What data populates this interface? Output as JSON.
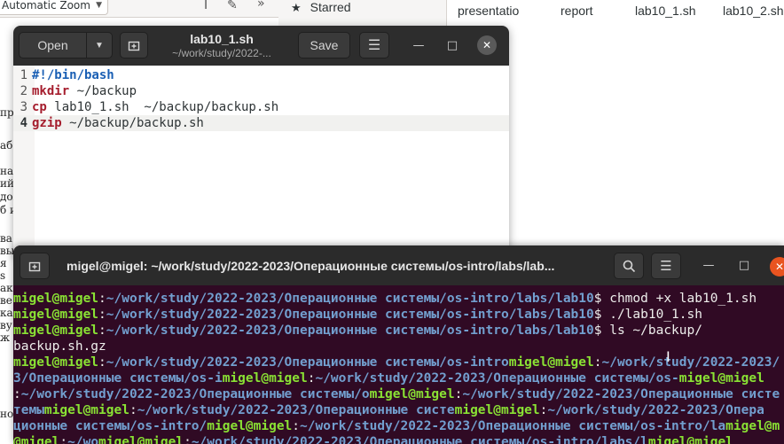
{
  "pdf_viewer": {
    "zoom_value": "Automatic Zoom",
    "side_text": [
      "пр",
      "або",
      "нат",
      "ий",
      "дол",
      "б и",
      "ва",
      "вы",
      "я",
      "s",
      "ак",
      "ве",
      "кач",
      "ву",
      "ж",
      "но"
    ]
  },
  "file_manager": {
    "sidebar_starred": "Starred",
    "files": [
      "presentatio",
      "report",
      "lab10_1.sh",
      "lab10_2.sh"
    ]
  },
  "gedit": {
    "open_label": "Open",
    "save_label": "Save",
    "title": "lab10_1.sh",
    "subtitle": "~/work/study/2022-...",
    "lines": [
      {
        "num": "1",
        "kw": "#!/bin/bash",
        "rest": ""
      },
      {
        "num": "2",
        "kw": "mkdir",
        "rest": " ~/backup"
      },
      {
        "num": "3",
        "kw": "cp",
        "rest": " lab10_1.sh  ~/backup/backup.sh"
      },
      {
        "num": "4",
        "kw": "gzip",
        "rest": " ~/backup/backup.sh"
      }
    ]
  },
  "terminal": {
    "title": "migel@migel: ~/work/study/2022-2023/Операционные системы/os-intro/labs/lab...",
    "lines": [
      [
        {
          "c": "u",
          "t": "migel@migel"
        },
        {
          "c": "plain",
          "t": ":"
        },
        {
          "c": "p",
          "t": "~/work/study/2022-2023/Операционные системы/os-intro/labs/lab10"
        },
        {
          "c": "plain",
          "t": "$ chmod +x lab10_1.sh"
        }
      ],
      [
        {
          "c": "u",
          "t": "migel@migel"
        },
        {
          "c": "plain",
          "t": ":"
        },
        {
          "c": "p",
          "t": "~/work/study/2022-2023/Операционные системы/os-intro/labs/lab10"
        },
        {
          "c": "plain",
          "t": "$ ./lab10_1.sh"
        }
      ],
      [
        {
          "c": "u",
          "t": "migel@migel"
        },
        {
          "c": "plain",
          "t": ":"
        },
        {
          "c": "p",
          "t": "~/work/study/2022-2023/Операционные системы/os-intro/labs/lab10"
        },
        {
          "c": "plain",
          "t": "$ ls ~/backup/"
        }
      ],
      [
        {
          "c": "plain",
          "t": "backup.sh.gz"
        }
      ],
      [
        {
          "c": "u",
          "t": "migel@migel"
        },
        {
          "c": "plain",
          "t": ":"
        },
        {
          "c": "p",
          "t": "~/work/study/2022-2023/Операционные системы/os-intro"
        },
        {
          "c": "u",
          "t": "migel@migel"
        },
        {
          "c": "plain",
          "t": ":"
        },
        {
          "c": "p",
          "t": "~/work/study/2022-2023/"
        }
      ],
      [
        {
          "c": "p",
          "t": "3/Операционные системы/os-i"
        },
        {
          "c": "u",
          "t": "migel@migel"
        },
        {
          "c": "plain",
          "t": ":"
        },
        {
          "c": "p",
          "t": "~/work/study/2022-2023/Операционные системы/os-"
        },
        {
          "c": "u",
          "t": "migel@migel"
        }
      ],
      [
        {
          "c": "plain",
          "t": ":"
        },
        {
          "c": "p",
          "t": "~/work/study/2022-2023/Операционные системы/о"
        },
        {
          "c": "u",
          "t": "migel@migel"
        },
        {
          "c": "plain",
          "t": ":"
        },
        {
          "c": "p",
          "t": "~/work/study/2022-2023/Операционные систе"
        }
      ],
      [
        {
          "c": "p",
          "t": "темы"
        },
        {
          "c": "u",
          "t": "migel@migel"
        },
        {
          "c": "plain",
          "t": ":"
        },
        {
          "c": "p",
          "t": "~/work/study/2022-2023/Операционные систе"
        },
        {
          "c": "u",
          "t": "migel@migel"
        },
        {
          "c": "plain",
          "t": ":"
        },
        {
          "c": "p",
          "t": "~/work/study/2022-2023/Опера"
        }
      ],
      [
        {
          "c": "p",
          "t": "ционные системы/os-intro/"
        },
        {
          "c": "u",
          "t": "migel@migel"
        },
        {
          "c": "plain",
          "t": ":"
        },
        {
          "c": "p",
          "t": "~/work/study/2022-2023/Операционные системы/os-intro/la"
        },
        {
          "c": "u",
          "t": "migel@m"
        }
      ],
      [
        {
          "c": "u",
          "t": "@migel"
        },
        {
          "c": "plain",
          "t": ":"
        },
        {
          "c": "p",
          "t": "~/wo"
        },
        {
          "c": "u",
          "t": "migel@migel"
        },
        {
          "c": "plain",
          "t": ":"
        },
        {
          "c": "p",
          "t": "~/work/study/2022-2023/Операционные системы/os-intro/labs/l"
        },
        {
          "c": "u",
          "t": "migel@migel"
        }
      ]
    ]
  }
}
